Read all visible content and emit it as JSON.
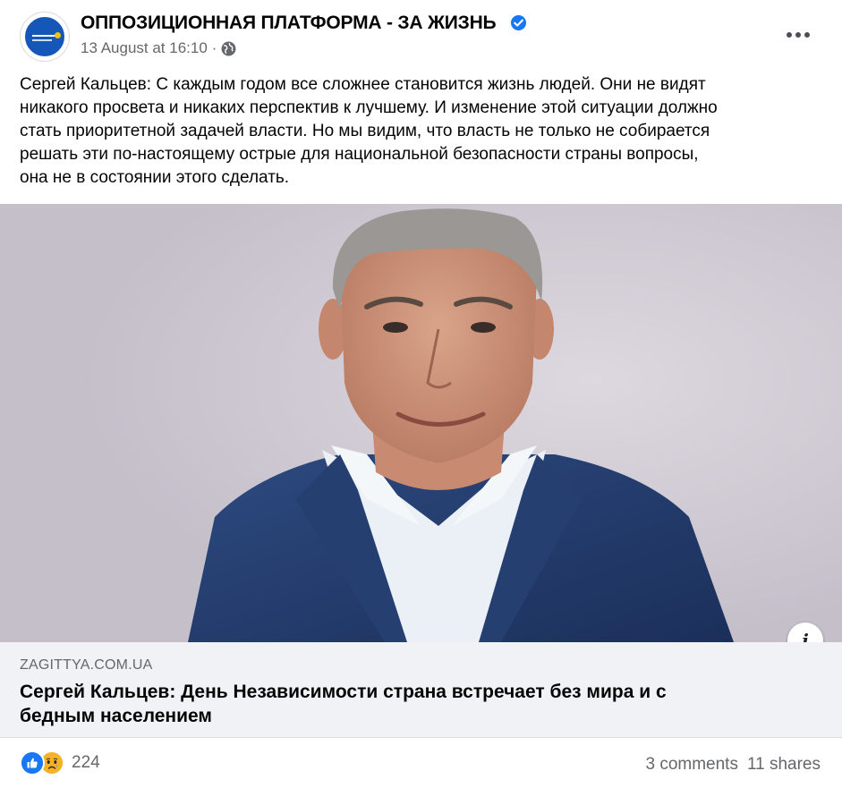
{
  "post": {
    "page_name": "ОППОЗИЦИОННАЯ ПЛАТФОРМА - ЗА ЖИЗНЬ",
    "timestamp": "13 August at 16:10",
    "separator": "·",
    "privacy_icon": "globe-icon",
    "verified_icon": "verified-badge-icon",
    "more_icon": "more-options-icon",
    "text_lines": [
      "Сергей Кальцев: С каждым годом все сложнее становится жизнь людей. Они не видят",
      "никакого просвета и никаких перспектив к лучшему. И изменение этой ситуации должно",
      "стать приоритетной задачей власти. Но мы видим, что власть не только не собирается",
      "решать эти по-настоящему острые для национальной безопасности страны вопросы,",
      "она не в состоянии этого сделать."
    ]
  },
  "link": {
    "domain": "ZAGITTYA.COM.UA",
    "title_lines": [
      "Сергей Кальцев: День Независимости страна встречает без мира и с",
      "бедным населением"
    ],
    "info_label": "i"
  },
  "footer": {
    "reaction_icons": [
      "like-icon",
      "sad-icon"
    ],
    "reaction_count": "224",
    "comments": "3 comments",
    "shares": "11 shares"
  },
  "colors": {
    "brand_blue": "#1877f2",
    "secondary_text": "#65676b",
    "link_bg": "#f0f2f5"
  }
}
